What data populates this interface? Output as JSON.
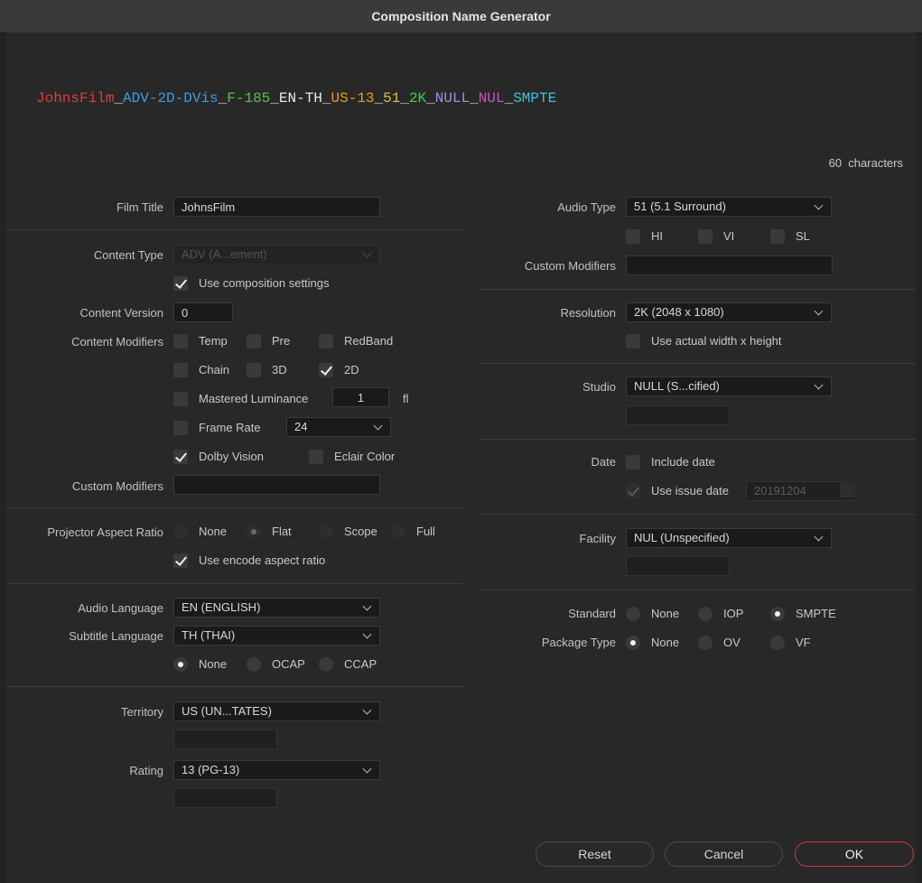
{
  "window_title": "Composition Name Generator",
  "generated_name": {
    "segments": [
      {
        "text": "JohnsFilm",
        "color": "#e03b3b"
      },
      {
        "text": "_",
        "color": "#bfbfbf"
      },
      {
        "text": "ADV-2D-DVis",
        "color": "#3f9be0"
      },
      {
        "text": "_",
        "color": "#bfbfbf"
      },
      {
        "text": "F-185",
        "color": "#58c24a"
      },
      {
        "text": "_",
        "color": "#bfbfbf"
      },
      {
        "text": "EN-TH",
        "color": "#e8e8e8"
      },
      {
        "text": "_",
        "color": "#bfbfbf"
      },
      {
        "text": "US-13",
        "color": "#e89a2c"
      },
      {
        "text": "_",
        "color": "#bfbfbf"
      },
      {
        "text": "51",
        "color": "#d8c23a"
      },
      {
        "text": "_",
        "color": "#bfbfbf"
      },
      {
        "text": "2K",
        "color": "#3fd14a"
      },
      {
        "text": "_",
        "color": "#bfbfbf"
      },
      {
        "text": "NULL",
        "color": "#a78adf"
      },
      {
        "text": "_",
        "color": "#bfbfbf"
      },
      {
        "text": "NUL",
        "color": "#d04fc9"
      },
      {
        "text": "_",
        "color": "#bfbfbf"
      },
      {
        "text": "SMPTE",
        "color": "#3fc3d8"
      }
    ],
    "char_count": "60",
    "char_label": "characters"
  },
  "left": {
    "film_title": {
      "label": "Film Title",
      "value": "JohnsFilm"
    },
    "content_type": {
      "label": "Content Type",
      "value": "ADV (A...ement)",
      "use_comp_label": "Use composition settings"
    },
    "content_version": {
      "label": "Content Version",
      "value": "0"
    },
    "content_modifiers": {
      "label": "Content Modifiers",
      "temp": "Temp",
      "pre": "Pre",
      "redband": "RedBand",
      "chain": "Chain",
      "three_d": "3D",
      "two_d": "2D",
      "mastered_lum": "Mastered Luminance",
      "mastered_lum_value": "1",
      "mastered_lum_unit": "fl",
      "frame_rate": "Frame Rate",
      "frame_rate_value": "24",
      "dolby_vision": "Dolby Vision",
      "eclair_color": "Eclair Color"
    },
    "custom_modifiers": {
      "label": "Custom Modifiers",
      "value": ""
    },
    "projector_aspect": {
      "label": "Projector Aspect Ratio",
      "none": "None",
      "flat": "Flat",
      "scope": "Scope",
      "full": "Full",
      "use_encode_label": "Use encode aspect ratio"
    },
    "audio_language": {
      "label": "Audio Language",
      "value": "EN (ENGLISH)"
    },
    "subtitle_language": {
      "label": "Subtitle Language",
      "value": "TH (THAI)",
      "none": "None",
      "ocap": "OCAP",
      "ccap": "CCAP"
    },
    "territory": {
      "label": "Territory",
      "value": "US (UN...TATES)"
    },
    "rating": {
      "label": "Rating",
      "value": "13 (PG-13)"
    }
  },
  "right": {
    "audio_type": {
      "label": "Audio Type",
      "value": "51 (5.1 Surround)",
      "hi": "HI",
      "vi": "VI",
      "sl": "SL"
    },
    "custom_modifiers": {
      "label": "Custom Modifiers",
      "value": ""
    },
    "resolution": {
      "label": "Resolution",
      "value": "2K (2048 x 1080)",
      "use_actual_label": "Use actual width x height"
    },
    "studio": {
      "label": "Studio",
      "value": "NULL (S...cified)"
    },
    "date": {
      "label": "Date",
      "include_label": "Include date",
      "use_issue_label": "Use issue date",
      "issue_value": "20191204"
    },
    "facility": {
      "label": "Facility",
      "value": "NUL (Unspecified)"
    },
    "standard": {
      "label": "Standard",
      "none": "None",
      "iop": "IOP",
      "smpte": "SMPTE"
    },
    "package_type": {
      "label": "Package Type",
      "none": "None",
      "ov": "OV",
      "vf": "VF"
    }
  },
  "buttons": {
    "reset": "Reset",
    "cancel": "Cancel",
    "ok": "OK"
  }
}
